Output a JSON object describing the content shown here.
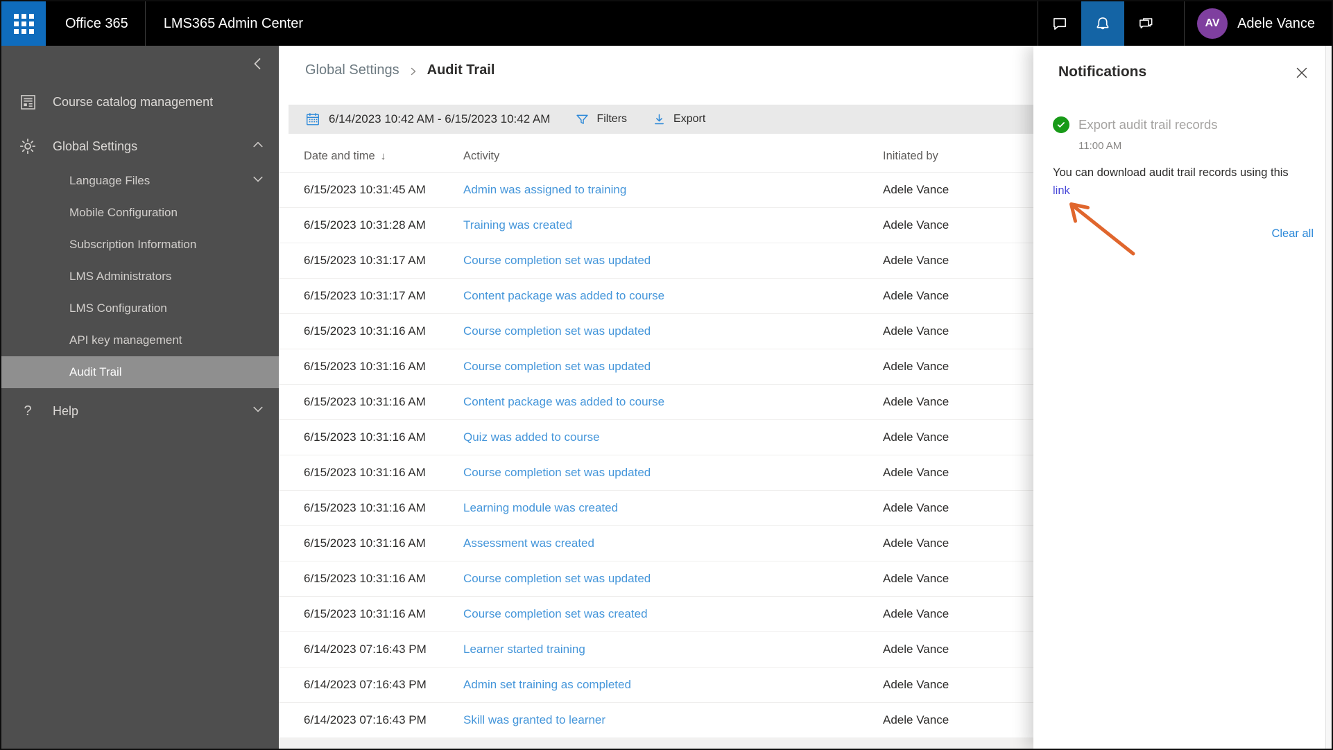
{
  "topbar": {
    "brand": "Office 365",
    "app_title": "LMS365 Admin Center",
    "user_initials": "AV",
    "user_name": "Adele Vance"
  },
  "sidebar": {
    "course_catalog": "Course catalog management",
    "global_settings": "Global Settings",
    "sub_items": [
      "Language Files",
      "Mobile Configuration",
      "Subscription Information",
      "LMS Administrators",
      "LMS Configuration",
      "API key management",
      "Audit Trail"
    ],
    "selected_item": "Audit Trail",
    "help": "Help"
  },
  "breadcrumb": {
    "parent": "Global Settings",
    "current": "Audit Trail"
  },
  "toolbar": {
    "date_range": "6/14/2023 10:42 AM - 6/15/2023 10:42 AM",
    "filters_label": "Filters",
    "export_label": "Export"
  },
  "table": {
    "headers": [
      "Date and time",
      "Activity",
      "Initiated by"
    ],
    "sort_arrow": "↓",
    "rows": [
      {
        "date": "6/15/2023 10:31:45 AM",
        "activity": "Admin was assigned to training",
        "initiated": "Adele Vance"
      },
      {
        "date": "6/15/2023 10:31:28 AM",
        "activity": "Training was created",
        "initiated": "Adele Vance"
      },
      {
        "date": "6/15/2023 10:31:17 AM",
        "activity": "Course completion set was updated",
        "initiated": "Adele Vance"
      },
      {
        "date": "6/15/2023 10:31:17 AM",
        "activity": "Content package was added to course",
        "initiated": "Adele Vance"
      },
      {
        "date": "6/15/2023 10:31:16 AM",
        "activity": "Course completion set was updated",
        "initiated": "Adele Vance"
      },
      {
        "date": "6/15/2023 10:31:16 AM",
        "activity": "Course completion set was updated",
        "initiated": "Adele Vance"
      },
      {
        "date": "6/15/2023 10:31:16 AM",
        "activity": "Content package was added to course",
        "initiated": "Adele Vance"
      },
      {
        "date": "6/15/2023 10:31:16 AM",
        "activity": "Quiz was added to course",
        "initiated": "Adele Vance"
      },
      {
        "date": "6/15/2023 10:31:16 AM",
        "activity": "Course completion set was updated",
        "initiated": "Adele Vance"
      },
      {
        "date": "6/15/2023 10:31:16 AM",
        "activity": "Learning module was created",
        "initiated": "Adele Vance"
      },
      {
        "date": "6/15/2023 10:31:16 AM",
        "activity": "Assessment was created",
        "initiated": "Adele Vance"
      },
      {
        "date": "6/15/2023 10:31:16 AM",
        "activity": "Course completion set was updated",
        "initiated": "Adele Vance"
      },
      {
        "date": "6/15/2023 10:31:16 AM",
        "activity": "Course completion set was created",
        "initiated": "Adele Vance"
      },
      {
        "date": "6/14/2023 07:16:43 PM",
        "activity": "Learner started training",
        "initiated": "Adele Vance"
      },
      {
        "date": "6/14/2023 07:16:43 PM",
        "activity": "Admin set training as completed",
        "initiated": "Adele Vance"
      },
      {
        "date": "6/14/2023 07:16:43 PM",
        "activity": "Skill was granted to learner",
        "initiated": "Adele Vance"
      }
    ]
  },
  "notifications": {
    "title": "Notifications",
    "item": {
      "status": "success",
      "title": "Export audit trail records",
      "time": "11:00 AM",
      "body": "You can download audit trail records using this",
      "link_text": "link"
    },
    "clear_all": "Clear all"
  },
  "icons": {
    "app-launcher-icon": "waffle-grid",
    "chat-icon": "speech-bubble",
    "bell-icon": "bell (active)",
    "feedback-icon": "double-speech-bubble",
    "catalog-icon": "document-list",
    "gear-icon": "gear",
    "help-icon": "?",
    "collapse-icon": "chevron-left",
    "chevron-up-icon": "chevron-up",
    "chevron-down-icon": "chevron-down",
    "calendar-icon": "calendar",
    "filter-icon": "funnel",
    "export-icon": "download-arrow",
    "sort-desc-icon": "down-arrow",
    "success-icon": "check-circle",
    "close-icon": "x",
    "annotation-arrow-icon": "orange-arrow"
  },
  "colors": {
    "suite_blue": "#0f6cbd",
    "bell_active_blue": "#1464a5",
    "avatar_purple": "#7f3f9f",
    "sidebar_gray": "#4e4e4e",
    "sidebar_selected": "#8f8f8f",
    "accent_blue": "#2b88d8",
    "activity_link_blue": "#4596da",
    "notification_link_blue": "#4646d8",
    "success_green": "#189a18",
    "annotation_orange": "#e0662d"
  }
}
